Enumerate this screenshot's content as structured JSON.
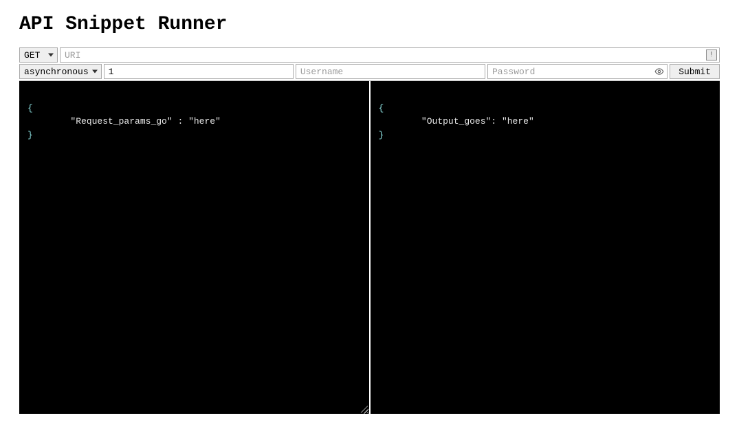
{
  "title": "API Snippet Runner",
  "row1": {
    "method": "GET",
    "uri_value": "",
    "uri_placeholder": "URI",
    "badge_glyph": "!"
  },
  "row2": {
    "mode": "asynchronous",
    "count_value": "1",
    "count_placeholder": "",
    "username_value": "",
    "username_placeholder": "Username",
    "password_value": "",
    "password_placeholder": "Password",
    "submit_label": "Submit"
  },
  "request_body": {
    "open_brace": "{",
    "line_key": "\"Request_params_go\"",
    "line_colon": " : ",
    "line_val": "\"here\"",
    "close_brace": "}"
  },
  "output_body": {
    "open_brace": "{",
    "line_key": "\"Output_goes\"",
    "line_colon": ": ",
    "line_val": "\"here\"",
    "close_brace": "}"
  }
}
